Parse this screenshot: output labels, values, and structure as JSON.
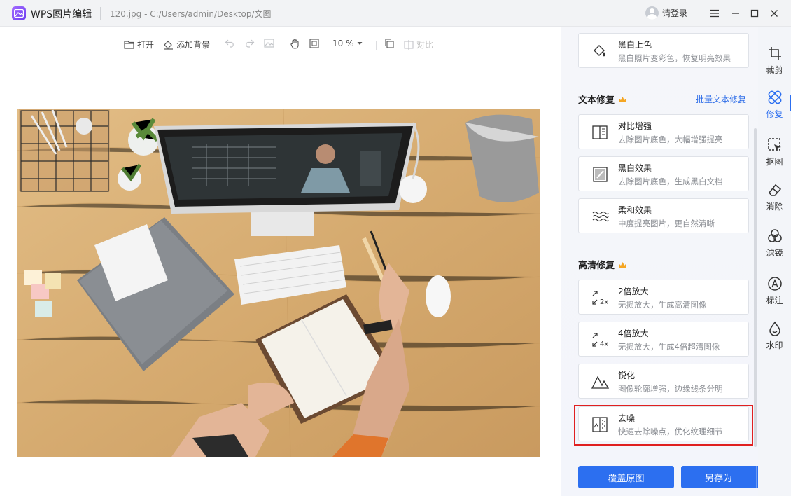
{
  "titlebar": {
    "app_name": "WPS图片编辑",
    "file_path": "120.jpg - C:/Users/admin/Desktop/文图",
    "login_label": "请登录",
    "icons": [
      "app-logo",
      "avatar",
      "menu-icon",
      "minimize-icon",
      "maximize-icon",
      "close-icon"
    ]
  },
  "toolbar": {
    "open_label": "打开",
    "add_bg_label": "添加背景",
    "zoom_value": "10 %",
    "compare_label": "对比"
  },
  "panel": {
    "top_card": {
      "title": "黑白上色",
      "desc": "黑白照片变彩色，恢复明亮效果"
    },
    "text_repair": {
      "title": "文本修复",
      "batch_link": "批量文本修复",
      "cards": [
        {
          "title": "对比增强",
          "desc": "去除图片底色，大幅增强提亮"
        },
        {
          "title": "黑白效果",
          "desc": "去除图片底色，生成黑白文档"
        },
        {
          "title": "柔和效果",
          "desc": "中度提亮图片，更自然清晰"
        }
      ]
    },
    "hd_repair": {
      "title": "高清修复",
      "cards": [
        {
          "title": "2倍放大",
          "desc": "无损放大，生成高清图像",
          "icon_text": "2x"
        },
        {
          "title": "4倍放大",
          "desc": "无损放大，生成4倍超清图像",
          "icon_text": "4x"
        },
        {
          "title": "锐化",
          "desc": "图像轮廓增强，边缘线条分明"
        },
        {
          "title": "去噪",
          "desc": "快速去除噪点，优化纹理细节"
        }
      ]
    },
    "overwrite_label": "覆盖原图",
    "save_as_label": "另存为",
    "accent_color": "#2c6ff0",
    "highlight_color": "#e02020"
  },
  "sidebar": {
    "items": [
      {
        "label": "裁剪",
        "icon": "crop-icon"
      },
      {
        "label": "修复",
        "icon": "repair-icon",
        "active": true
      },
      {
        "label": "抠图",
        "icon": "cutout-icon"
      },
      {
        "label": "消除",
        "icon": "eraser-icon"
      },
      {
        "label": "滤镜",
        "icon": "filter-icon"
      },
      {
        "label": "标注",
        "icon": "annotate-icon"
      },
      {
        "label": "水印",
        "icon": "watermark-icon"
      }
    ]
  },
  "photo": {
    "description_icon": "photo-desk-image"
  }
}
